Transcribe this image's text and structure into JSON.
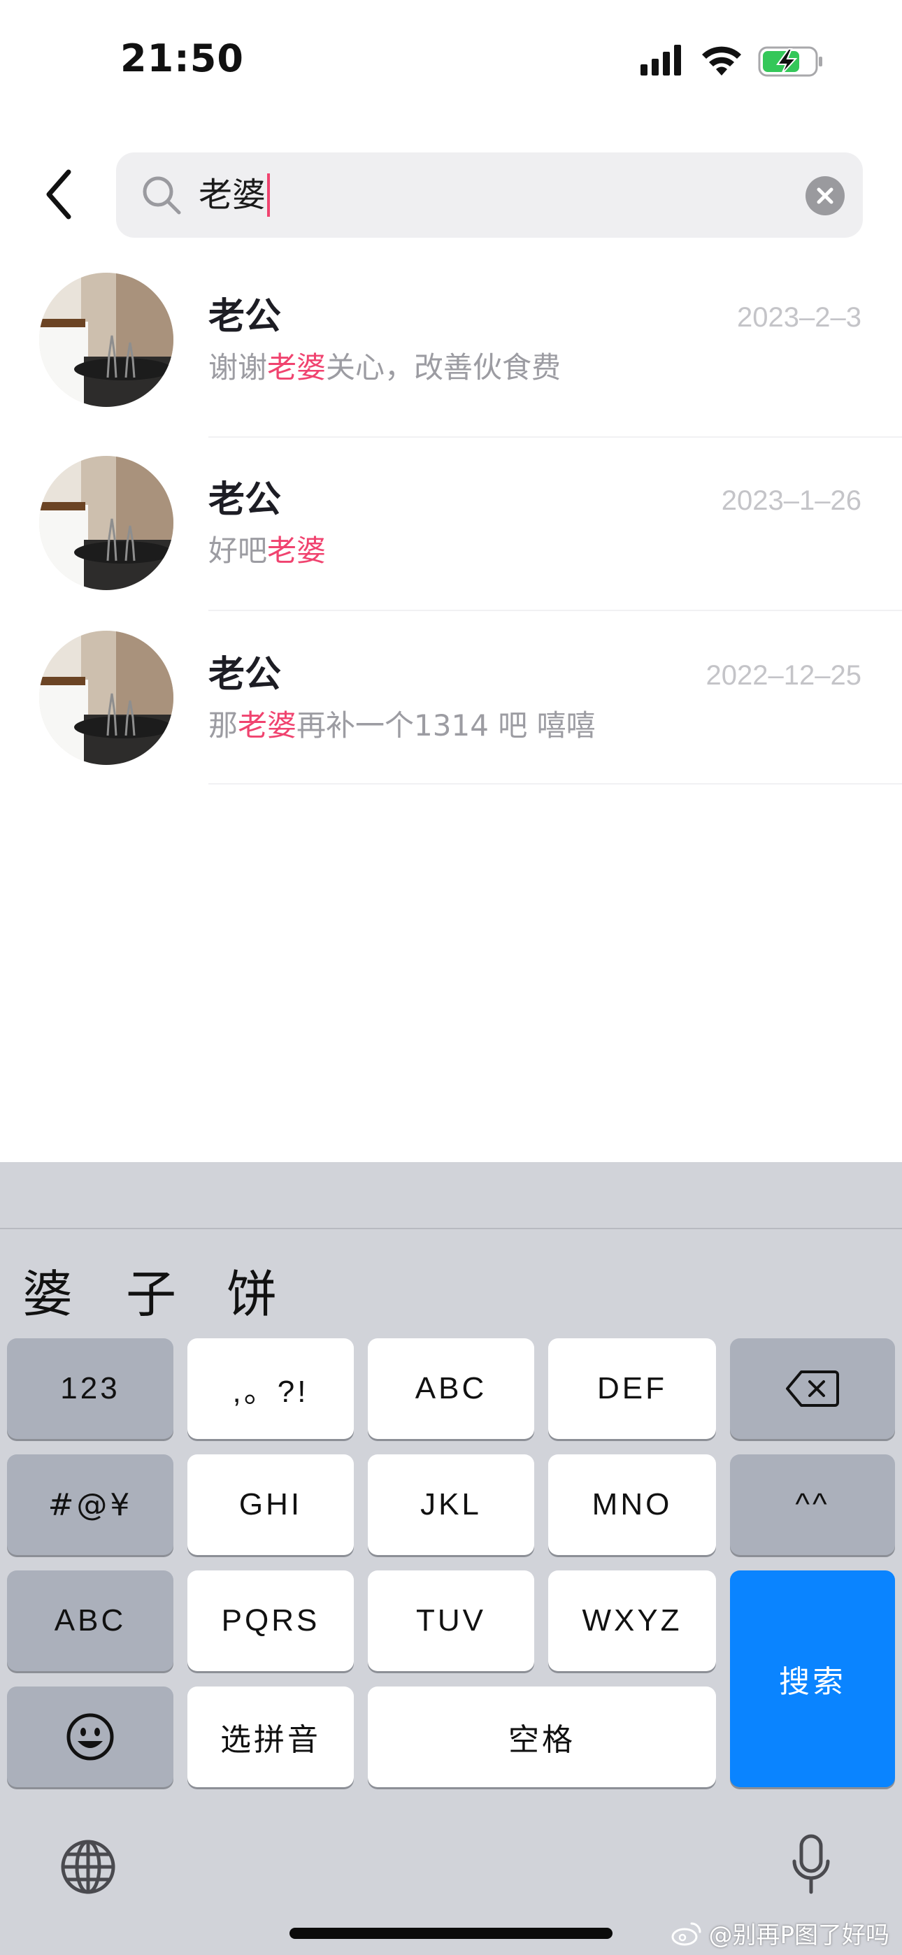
{
  "status_bar": {
    "time": "21:50",
    "icons": [
      "signal-icon",
      "wifi-icon",
      "battery-charging-icon"
    ],
    "battery_color": "#34c759"
  },
  "search": {
    "query": "老婆",
    "caret_color": "#f0436f"
  },
  "results": [
    {
      "name": "老公",
      "date": "2023–2–3",
      "snippet_before": "谢谢",
      "snippet_highlight": "老婆",
      "snippet_after": "关心，改善伙食费"
    },
    {
      "name": "老公",
      "date": "2023–1–26",
      "snippet_before": "好吧",
      "snippet_highlight": "老婆",
      "snippet_after": ""
    },
    {
      "name": "老公",
      "date": "2022–12–25",
      "snippet_before": "那",
      "snippet_highlight": "老婆",
      "snippet_after": "再补一个1314 吧 嘻嘻"
    }
  ],
  "highlight_color": "#f0436f",
  "keyboard": {
    "candidates": [
      "婆",
      "子",
      "饼"
    ],
    "rows": [
      [
        "123",
        ",。?!",
        "ABC",
        "DEF",
        "delete-icon"
      ],
      [
        "#@¥",
        "GHI",
        "JKL",
        "MNO",
        "^^"
      ],
      [
        "ABC",
        "PQRS",
        "TUV",
        "WXYZ"
      ],
      [
        "emoji-icon",
        "选拼音",
        "空格"
      ]
    ],
    "keys": {
      "num": "123",
      "punct": ",。?!",
      "abc2": "ABC",
      "def3": "DEF",
      "sym": "#@¥",
      "ghi4": "GHI",
      "jkl5": "JKL",
      "mno6": "MNO",
      "kaomoji": "^^",
      "abc": "ABC",
      "pqrs7": "PQRS",
      "tuv8": "TUV",
      "wxyz9": "WXYZ",
      "pinyin": "选拼音",
      "space": "空格",
      "search": "搜索"
    },
    "accent_color": "#0a84ff"
  },
  "watermark": "@别再P图了好吗"
}
